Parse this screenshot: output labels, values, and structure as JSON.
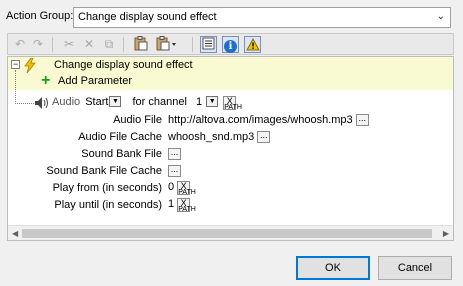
{
  "action_group": {
    "label": "Action Group:",
    "value": "Change display sound effect"
  },
  "toolbar": {
    "icons": [
      "undo-icon",
      "redo-icon",
      "cut-icon",
      "delete-icon",
      "copy-icon",
      "paste-icon",
      "paste-special-icon",
      "list-view-icon",
      "info-icon",
      "warning-icon"
    ]
  },
  "tree": {
    "action_title": "Change display sound effect",
    "add_parameter": "Add Parameter",
    "audio": {
      "label": "Audio",
      "mode": "Start",
      "for_channel_label": "for channel",
      "channel": "1"
    },
    "rows": [
      {
        "label": "Audio File",
        "value": "http://altova.com/images/whoosh.mp3",
        "button": "..."
      },
      {
        "label": "Audio File Cache",
        "value": "whoosh_snd.mp3",
        "button": "..."
      },
      {
        "label": "Sound Bank File",
        "value": "",
        "button": "..."
      },
      {
        "label": "Sound Bank File Cache",
        "value": "",
        "button": "..."
      },
      {
        "label": "Play from (in seconds)",
        "value": "0",
        "button": "path"
      },
      {
        "label": "Play until (in seconds)",
        "value": "1",
        "button": "path"
      }
    ]
  },
  "buttons": {
    "ok": "OK",
    "cancel": "Cancel"
  },
  "path_button": {
    "x": "X",
    "text": "PATH"
  },
  "colors": {
    "highlight_row": "#fafad2",
    "add_icon": "#1a9e1a",
    "info": "#1e6fd0",
    "warning": "#f2c200",
    "focus_border": "#0078d7"
  }
}
